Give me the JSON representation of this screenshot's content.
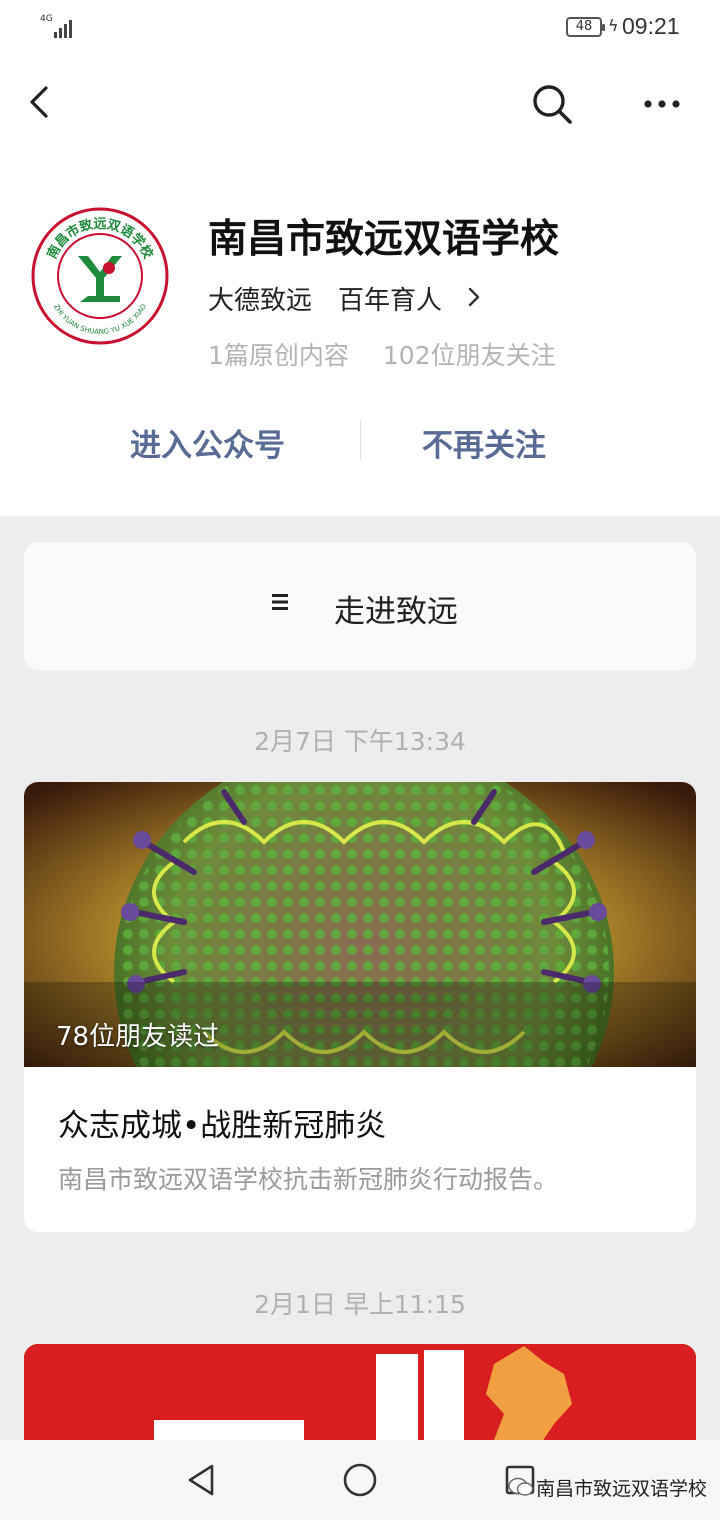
{
  "status_bar": {
    "network": "4G",
    "battery": "48",
    "time": "09:21"
  },
  "nav": {
    "icons": [
      "back-icon",
      "search-icon",
      "more-icon"
    ]
  },
  "profile": {
    "name": "南昌市致远双语学校",
    "slogan": "大德致远　百年育人",
    "original_count": "1篇原创内容",
    "followers": "102位朋友关注",
    "enter_button": "进入公众号",
    "unfollow_button": "不再关注",
    "logo_text_top": "南昌市致远双语学校",
    "logo_text_bottom": "ZHI YUAN SHUANG YU XUE XIAO"
  },
  "menu": {
    "label": "走进致远",
    "icon": "menu-icon"
  },
  "feed": [
    {
      "date": "2月7日 下午13:34",
      "read_count": "78位朋友读过",
      "title": "众志成城•战胜新冠肺炎",
      "summary": "南昌市致远双语学校抗击新冠肺炎行动报告。"
    },
    {
      "date": "2月1日 早上11:15"
    }
  ],
  "system_nav": {
    "icons": [
      "nav-back-icon",
      "nav-home-icon",
      "nav-recent-icon"
    ],
    "watermark": "南昌市致远双语学校"
  },
  "colors": {
    "link": "#576b95",
    "background": "#ededed",
    "logo_green": "#1f8a3c",
    "logo_red": "#c8102e",
    "cover_red": "#d81e1e"
  }
}
